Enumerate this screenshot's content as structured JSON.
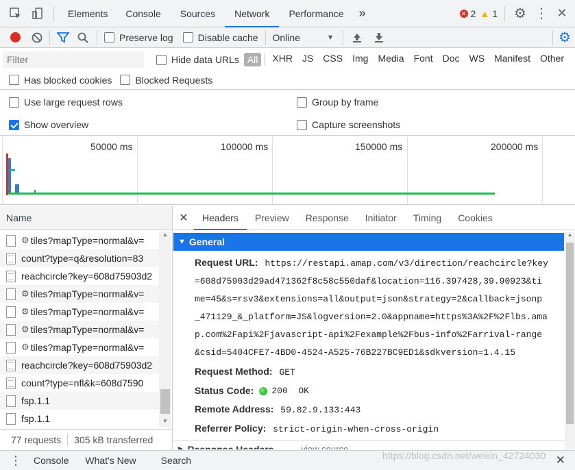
{
  "tabs": {
    "elements": "Elements",
    "console": "Console",
    "sources": "Sources",
    "network": "Network",
    "performance": "Performance",
    "more": "»",
    "error_count": "2",
    "warning_count": "1"
  },
  "toolbar": {
    "preserve_log": "Preserve log",
    "disable_cache": "Disable cache",
    "throttle": "Online"
  },
  "filter": {
    "placeholder": "Filter",
    "hide_data_urls": "Hide data URLs",
    "types": [
      "All",
      "XHR",
      "JS",
      "CSS",
      "Img",
      "Media",
      "Font",
      "Doc",
      "WS",
      "Manifest",
      "Other"
    ],
    "has_blocked_cookies": "Has blocked cookies",
    "blocked_requests": "Blocked Requests"
  },
  "settings": {
    "large_rows": "Use large request rows",
    "show_overview": "Show overview",
    "group_by_frame": "Group by frame",
    "capture_screenshots": "Capture screenshots"
  },
  "overview": {
    "ticks": [
      "50000 ms",
      "100000 ms",
      "150000 ms",
      "200000 ms"
    ]
  },
  "list": {
    "header": "Name",
    "rows": [
      {
        "name": "tiles?mapType=normal&v=",
        "type": "gear"
      },
      {
        "name": "count?type=q&resolution=83",
        "type": "doc"
      },
      {
        "name": "reachcircle?key=608d75903d2",
        "type": "doc"
      },
      {
        "name": "tiles?mapType=normal&v=",
        "type": "gear"
      },
      {
        "name": "tiles?mapType=normal&v=",
        "type": "gear"
      },
      {
        "name": "tiles?mapType=normal&v=",
        "type": "gear"
      },
      {
        "name": "tiles?mapType=normal&v=",
        "type": "gear"
      },
      {
        "name": "reachcircle?key=608d75903d2",
        "type": "doc"
      },
      {
        "name": "count?type=nfl&k=608d7590",
        "type": "doc"
      },
      {
        "name": "fsp.1.1",
        "type": "plain"
      },
      {
        "name": "fsp.1.1",
        "type": "plain"
      }
    ],
    "requests": "77 requests",
    "transferred": "305 kB transferred"
  },
  "detail": {
    "tabs": [
      "Headers",
      "Preview",
      "Response",
      "Initiator",
      "Timing",
      "Cookies"
    ],
    "section": "General",
    "request_url_label": "Request URL:",
    "request_url_lines": [
      "https://restapi.amap.com/v3/direction/reachcircle?key",
      "=608d75903d29ad471362f8c58c550daf&location=116.397428,39.90923&ti",
      "me=45&s=rsv3&extensions=all&output=json&strategy=2&callback=jsonp",
      "_471129_&_platform=JS&logversion=2.0&appname=https%3A%2F%2Flbs.ama",
      "p.com%2Fapi%2Fjavascript-api%2Fexample%2Fbus-info%2Farrival-range",
      "&csid=5404CFE7-4BD0-4524-A525-76B227BC9ED1&sdkversion=1.4.15"
    ],
    "method_label": "Request Method:",
    "method": "GET",
    "status_label": "Status Code:",
    "status": "200  OK",
    "remote_label": "Remote Address:",
    "remote": "59.82.9.133:443",
    "referrer_label": "Referrer Policy:",
    "referrer": "strict-origin-when-cross-origin",
    "next_section": "Response Headers",
    "view_source": "view source"
  },
  "drawer": {
    "tabs": [
      "Console",
      "What's New",
      "Search"
    ]
  },
  "watermark": "https://blog.csdn.net/weixin_42724030",
  "colors": {
    "accent": "#1a73e8",
    "record": "#d93025",
    "status_ok": "#0a0",
    "section_bg": "#1a73e8"
  }
}
